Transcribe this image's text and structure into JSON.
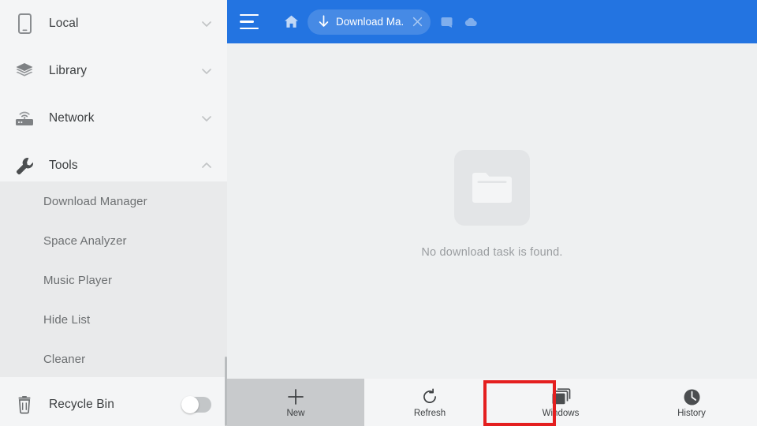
{
  "sidebar": {
    "items": [
      {
        "label": "Local",
        "icon": "phone-icon",
        "chevron": "chevron-down",
        "expanded": false
      },
      {
        "label": "Library",
        "icon": "layers-icon",
        "chevron": "chevron-down",
        "expanded": false
      },
      {
        "label": "Network",
        "icon": "router-icon",
        "chevron": "chevron-down",
        "expanded": false
      },
      {
        "label": "Tools",
        "icon": "wrench-icon",
        "chevron": "chevron-up",
        "expanded": true
      }
    ],
    "submenu": [
      {
        "label": "Download Manager",
        "selected": true
      },
      {
        "label": "Space Analyzer",
        "selected": false
      },
      {
        "label": "Music Player",
        "selected": false
      },
      {
        "label": "Hide List",
        "selected": false
      },
      {
        "label": "Cleaner",
        "selected": false
      }
    ],
    "recycle_bin": {
      "label": "Recycle Bin",
      "icon": "trash-icon",
      "toggle_on": false
    },
    "colors": {
      "background": "#f4f5f6",
      "submenu_background": "#e9eaeb",
      "text": "#3c3f41",
      "subtext": "#6c6f71"
    }
  },
  "header": {
    "menu_icon": "hamburger-icon",
    "home_icon": "home-icon",
    "tab": {
      "title": "Download Ma...",
      "icon": "download-arrow-icon",
      "close_icon": "close-icon"
    },
    "extra_icons": [
      {
        "name": "window-icon"
      },
      {
        "name": "cloud-icon"
      }
    ],
    "color": "#2374e1"
  },
  "content": {
    "empty_state": {
      "icon": "folder-icon",
      "message": "No download task is found."
    },
    "background": "#eef0f1"
  },
  "bottom_bar": {
    "items": [
      {
        "label": "New",
        "icon": "plus-icon",
        "highlighted": true
      },
      {
        "label": "Refresh",
        "icon": "refresh-icon",
        "highlighted": false
      },
      {
        "label": "Windows",
        "icon": "windows-icon",
        "highlighted": false
      },
      {
        "label": "History",
        "icon": "clock-icon",
        "highlighted": false
      }
    ],
    "highlight_color": "#e41f1f",
    "background": "#f4f5f6",
    "active_zone_background": "#c8cacc"
  }
}
